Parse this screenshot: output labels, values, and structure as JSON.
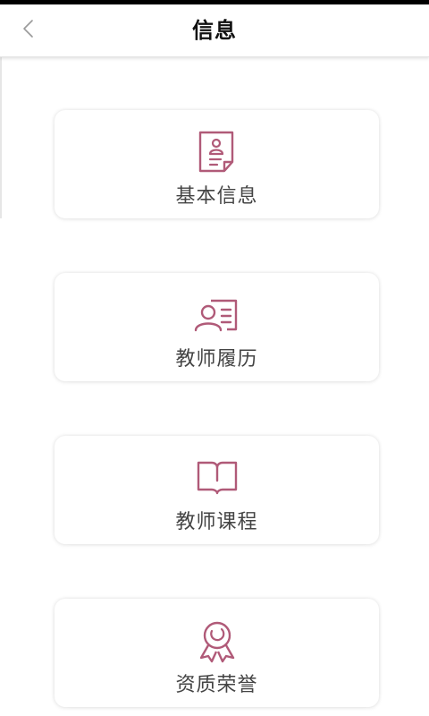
{
  "header": {
    "title": "信息",
    "back_icon": "chevron-left-icon"
  },
  "colors": {
    "accent": "#b05a78",
    "title_text": "#111111",
    "label_text": "#444444"
  },
  "menu": [
    {
      "label": "基本信息",
      "icon": "profile-document-icon"
    },
    {
      "label": "教师履历",
      "icon": "resume-icon"
    },
    {
      "label": "教师课程",
      "icon": "open-book-icon"
    },
    {
      "label": "资质荣誉",
      "icon": "medal-icon"
    }
  ]
}
